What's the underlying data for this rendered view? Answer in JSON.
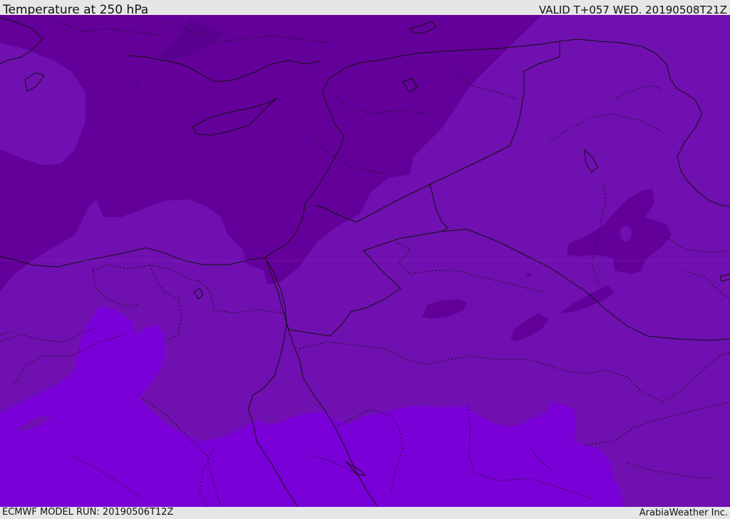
{
  "header": {
    "title": "Temperature at 250 hPa",
    "valid": "VALID T+057 WED. 20190508T21Z"
  },
  "footer": {
    "model_run": "ECMWF MODEL RUN: 20190506T12Z",
    "credit": "ArabiaWeather Inc."
  },
  "map": {
    "field": "temperature",
    "level": "250 hPa",
    "shading_colors": {
      "coldest": "#5a0090",
      "cold": "#64009a",
      "medium": "#7010b0",
      "warm": "#7a00d8"
    }
  }
}
